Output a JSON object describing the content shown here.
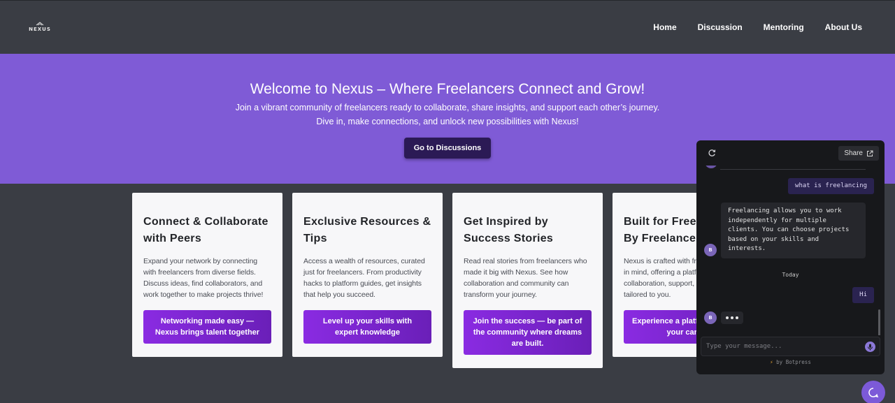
{
  "nav": {
    "logo_text": "NEXUS",
    "links": [
      "Home",
      "Discussion",
      "Mentoring",
      "About Us"
    ]
  },
  "hero": {
    "title": "Welcome to Nexus – Where Freelancers Connect and Grow!",
    "subtitle_line1": "Join a vibrant community of freelancers ready to collaborate, share insights, and support each other’s journey.",
    "subtitle_line2": "Dive in, make connections, and unlock new possibilities with Nexus!",
    "button": "Go to Discussions"
  },
  "cards": [
    {
      "title": "Connect & Collaborate with Peers",
      "desc": "Expand your network by connecting with freelancers from diverse fields. Discuss ideas, find collaborators, and work together to make projects thrive!",
      "button": "Networking made easy — Nexus brings talent together"
    },
    {
      "title": "Exclusive Resources & Tips",
      "desc": "Access a wealth of resources, curated just for freelancers. From productivity hacks to platform guides, get insights that help you succeed.",
      "button": "Level up your skills with expert knowledge"
    },
    {
      "title": "Get Inspired by Success Stories",
      "desc": "Read real stories from freelancers who made it big with Nexus. See how collaboration and community can transform your journey.",
      "button": "Join the success — be part of the community where dreams are built."
    },
    {
      "title": "Built for Freelancers, By Freelancers",
      "desc": "Nexus is crafted with freelancers' needs in mind, offering a platform for collaboration, support, and growth tailored to you.",
      "button": "Experience a platform built for your career"
    }
  ],
  "chat": {
    "share_label": "Share",
    "messages": {
      "user1": "what is freelancing",
      "bot1": "Freelancing allows you to work independently for multiple clients. You can choose projects based on your skills and interests.",
      "date_separator": "Today",
      "user2": "Hi"
    },
    "bot_avatar_letter": "B",
    "input_placeholder": "Type your message...",
    "powered_by": "by Botpress"
  },
  "colors": {
    "page_bg": "#3a3d44",
    "hero_bg": "#7f5bd6",
    "hero_button": "#2b1a55",
    "card_button_start": "#8a2be2",
    "card_button_end": "#6a1fb8",
    "chat_bg": "#17181b",
    "launcher": "#7c5ad8"
  },
  "icons": [
    "logo-mark",
    "refresh-icon",
    "external-link-icon",
    "mic-icon",
    "bolt-icon",
    "chat-bubble-icon"
  ]
}
